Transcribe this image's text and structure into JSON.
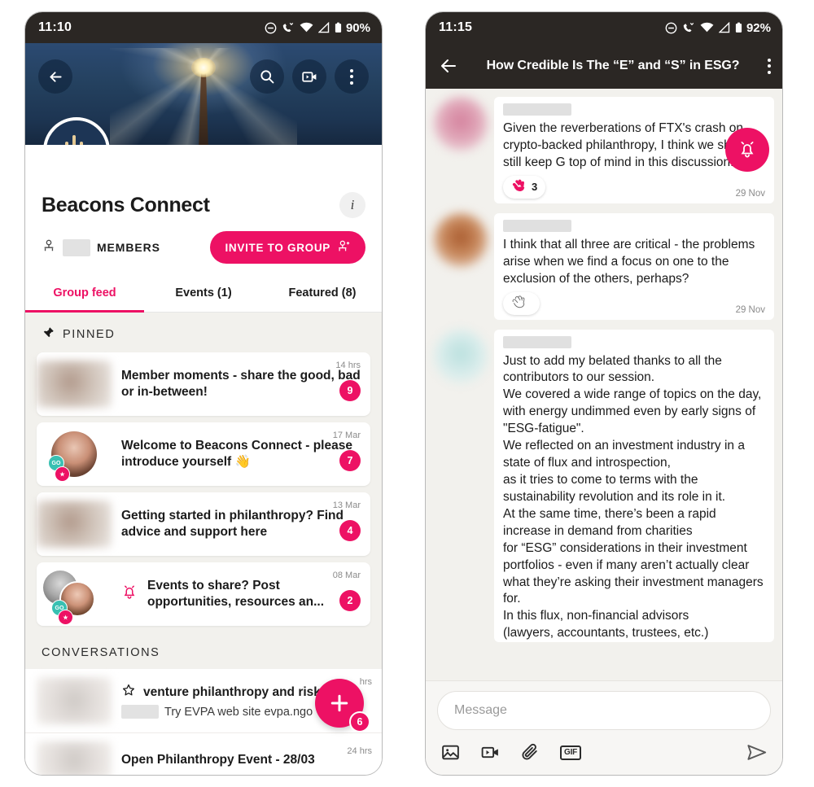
{
  "left_phone": {
    "status_bar": {
      "time": "11:10",
      "battery": "90%",
      "icons": [
        "dnd-icon",
        "missed-call-icon",
        "wifi-icon",
        "signal-icon",
        "battery-icon"
      ]
    },
    "hero": {
      "back_icon": "back-arrow-icon",
      "search_icon": "search-icon",
      "video_icon": "video-icon",
      "menu_icon": "overflow-menu-icon"
    },
    "group": {
      "name": "Beacons Connect",
      "info_icon": "info-icon",
      "members_label": "MEMBERS",
      "members_count_redacted": "",
      "invite_label": "INVITE TO GROUP",
      "invite_icon": "add-person-icon"
    },
    "tabs": [
      {
        "label": "Group feed",
        "active": true
      },
      {
        "label": "Events (1)",
        "active": false
      },
      {
        "label": "Featured (8)",
        "active": false
      }
    ],
    "pinned": {
      "section_label": "PINNED",
      "pin_icon": "pin-icon",
      "posts": [
        {
          "title": "Member moments - share the good, bad or in-between!",
          "time": "14 hrs",
          "count": "9",
          "avatar": "blurred-brown-thumb"
        },
        {
          "title": "Welcome to Beacons Connect - please introduce yourself 👋",
          "time": "17 Mar",
          "count": "7",
          "avatar": "woman-photo-avatar"
        },
        {
          "title": "Getting started in philanthropy? Find advice and support here",
          "time": "13 Mar",
          "count": "4",
          "avatar": "blurred-brown-thumb"
        },
        {
          "title": "Events to share? Post opportunities, resources an...",
          "time": "08 Mar",
          "count": "2",
          "avatar": "two-women-photo-avatars",
          "icon": "pink-bell-icon"
        }
      ]
    },
    "conversations": {
      "section_label": "CONVERSATIONS",
      "items": [
        {
          "title": "venture philanthropy and risk",
          "star_icon": "star-outline-icon",
          "subtitle": "Try EVPA web site evpa.ngo",
          "time": "hrs",
          "count": "6"
        },
        {
          "title": "Open Philanthropy Event - 28/03",
          "time": "24 hrs"
        }
      ]
    },
    "fab": {
      "icon": "plus-icon",
      "badge": "6"
    }
  },
  "right_phone": {
    "status_bar": {
      "time": "11:15",
      "battery": "92%",
      "icons": [
        "dnd-icon",
        "missed-call-icon",
        "wifi-icon",
        "signal-icon",
        "battery-icon"
      ]
    },
    "header": {
      "back_icon": "back-arrow-icon",
      "title": "How Credible Is The “E” and “S” in ESG?",
      "menu_icon": "overflow-menu-icon"
    },
    "notify_fab": {
      "icon": "alarm-bell-icon"
    },
    "messages": [
      {
        "author_redacted": "",
        "avatar": "blurred-pink-avatar",
        "text": "Given the reverberations of FTX's crash on crypto-backed philanthropy, I think we should still keep G top of mind in this discussion...",
        "time": "29 Nov",
        "reaction": {
          "icon": "clapping-hands-icon",
          "count": "3",
          "active": true
        }
      },
      {
        "author_redacted": "",
        "avatar": "blurred-rust-avatar",
        "text": "I think that all three are critical - the problems arise when we find a focus on one to the exclusion of the others, perhaps?",
        "time": "29 Nov",
        "reaction": {
          "icon": "clapping-hands-icon",
          "count": "",
          "active": false
        }
      },
      {
        "author_redacted": "",
        "avatar": "blurred-mint-avatar",
        "text": "Just to add my belated thanks to all the contributors to our session.\nWe covered a wide range of topics on the day, with energy undimmed even by early signs of \"ESG-fatigue\".\nWe reflected on an investment industry in a state of flux and introspection,\nas it tries to come to terms with the sustainability revolution and its role in it.\nAt the same time, there’s been a rapid increase in demand from charities\nfor “ESG” considerations in their investment portfolios - even if many aren’t actually clear what they’re asking their investment managers for.\nIn this flux, non-financial advisors\n(lawyers, accountants, trustees, etc.)",
        "time": "",
        "truncated": true
      }
    ],
    "composer": {
      "placeholder": "Message",
      "value": "",
      "icons": [
        "image-icon",
        "video-icon",
        "attachment-icon",
        "gif-icon"
      ],
      "gif_label": "GIF",
      "send_icon": "send-icon"
    }
  },
  "colors": {
    "accent": "#ed1164",
    "dark": "#2b2724",
    "feed_bg": "#f2f1ed",
    "navy": "#1d3555"
  }
}
